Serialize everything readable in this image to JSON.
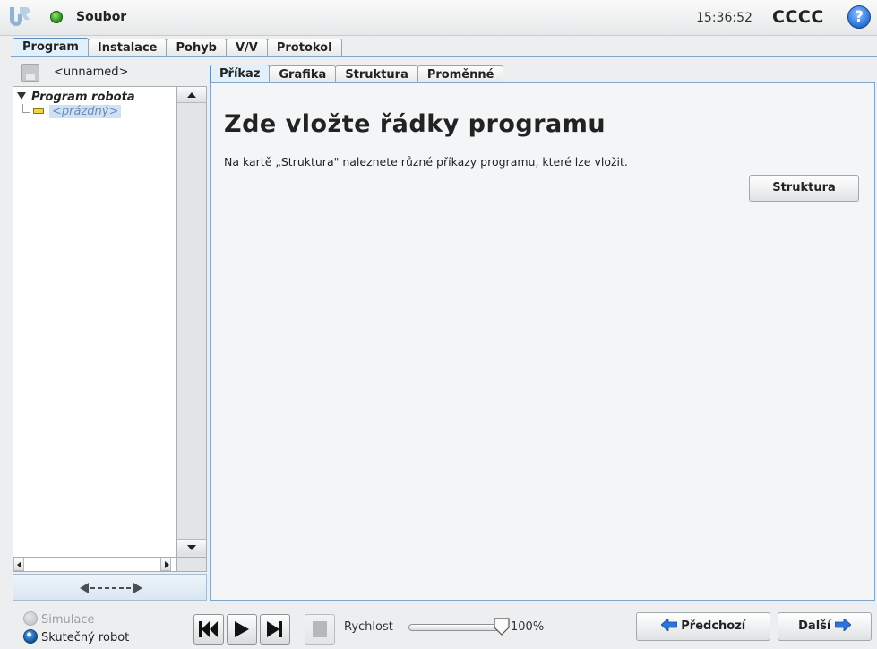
{
  "header": {
    "app_title": "Soubor",
    "clock": "15:36:52",
    "robot_name": "CCCC",
    "help_glyph": "?",
    "status_color": "#2f9b1f"
  },
  "main_tabs": [
    {
      "label": "Program",
      "active": true
    },
    {
      "label": "Instalace",
      "active": false
    },
    {
      "label": "Pohyb",
      "active": false
    },
    {
      "label": "V/V",
      "active": false
    },
    {
      "label": "Protokol",
      "active": false
    }
  ],
  "left_panel": {
    "program_name": "<unnamed>",
    "tree": {
      "root_label": "Program robota",
      "child_label": "<prázdný>"
    }
  },
  "sub_tabs": [
    {
      "label": "Příkaz",
      "active": true
    },
    {
      "label": "Grafika",
      "active": false
    },
    {
      "label": "Struktura",
      "active": false
    },
    {
      "label": "Proměnné",
      "active": false
    }
  ],
  "content": {
    "heading": "Zde vložte řádky programu",
    "description": "Na kartě „Struktura\" naleznete různé příkazy programu, které lze vložit.",
    "structure_button": "Struktura"
  },
  "bottom": {
    "simulation_label": "Simulace",
    "real_robot_label": "Skutečný robot",
    "mode": "real_robot",
    "speed_label": "Rychlost",
    "speed_value": "100%",
    "speed_fraction": 1.0,
    "prev_button": "Předchozí",
    "next_button": "Další"
  },
  "colors": {
    "accent": "#7fa5c8",
    "active_tab": "#e1f0fb",
    "selection": "#cfe2f5",
    "nav_arrow": "#2d74d8"
  }
}
